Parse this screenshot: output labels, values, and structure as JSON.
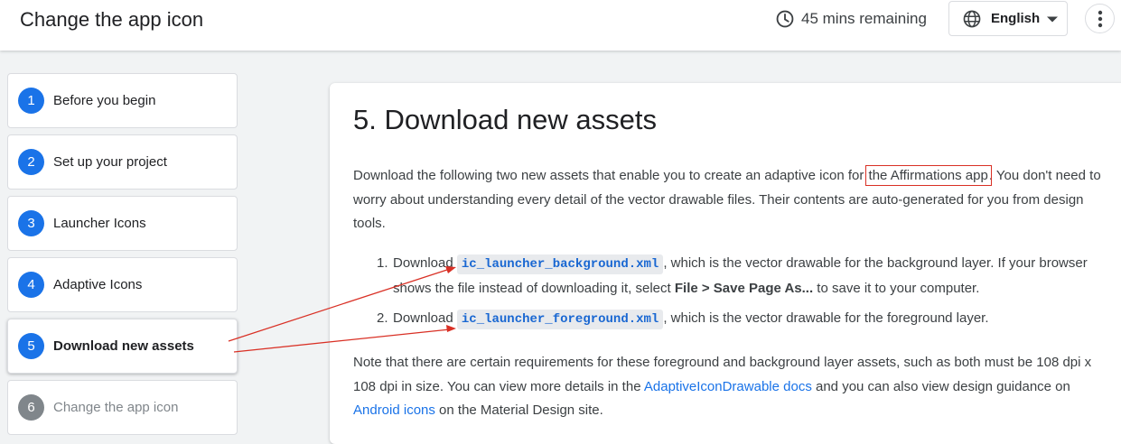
{
  "header": {
    "title": "Change the app icon",
    "time_remaining": "45 mins remaining",
    "language": "English"
  },
  "steps": [
    {
      "num": "1",
      "label": "Before you begin",
      "state": "default"
    },
    {
      "num": "2",
      "label": "Set up your project",
      "state": "default"
    },
    {
      "num": "3",
      "label": "Launcher Icons",
      "state": "default"
    },
    {
      "num": "4",
      "label": "Adaptive Icons",
      "state": "default"
    },
    {
      "num": "5",
      "label": "Download new assets",
      "state": "active"
    },
    {
      "num": "6",
      "label": "Change the app icon",
      "state": "disabled"
    }
  ],
  "content": {
    "title": "5. Download new assets",
    "intro_before": "Download the following two new assets that enable you to create an adaptive icon for ",
    "intro_highlight": "the Affirmations app",
    "intro_after": ". You don't need to worry about understanding every detail of the vector drawable files. Their contents are auto-generated for you from design tools.",
    "items": [
      {
        "num": "1.",
        "prefix": "Download ",
        "file": "ic_launcher_background.xml",
        "text_before_bold": ", which is the vector drawable for the background layer. If your browser shows the file instead of downloading it, select ",
        "bold": "File > Save Page As...",
        "text_after_bold": " to save it to your computer."
      },
      {
        "num": "2.",
        "prefix": "Download ",
        "file": "ic_launcher_foreground.xml",
        "text": ", which is the vector drawable for the foreground layer."
      }
    ],
    "note_part1": "Note that there are certain requirements for these foreground and background layer assets, such as both must be 108 dpi x 108 dpi in size. You can view more details in the ",
    "note_link1": "AdaptiveIconDrawable docs",
    "note_part2": " and you can also view design guidance on ",
    "note_link2": "Android icons",
    "note_part3": " on the Material Design site."
  },
  "annotation_color": "#d93025",
  "accent_color": "#1a73e8",
  "icons": [
    "clock-icon",
    "globe-icon",
    "caret-down-icon",
    "more-vert-icon"
  ]
}
